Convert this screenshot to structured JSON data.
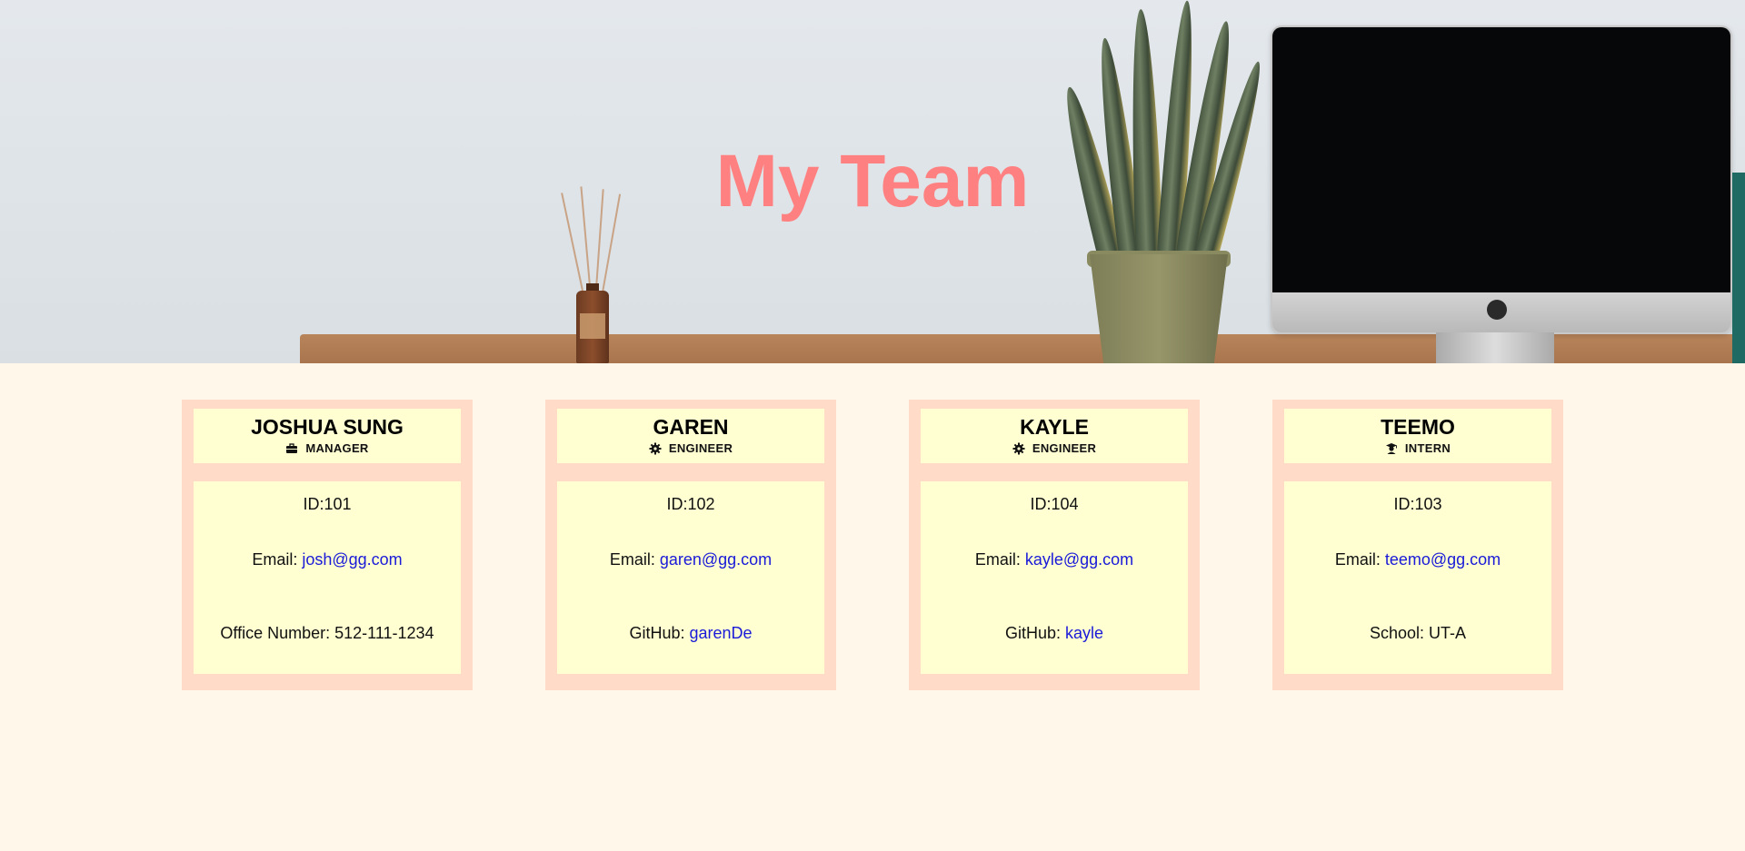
{
  "header": {
    "title": "My Team"
  },
  "colors": {
    "title": "#ff8080",
    "card_border": "#ffdbc8",
    "card_fill": "#ffffd2",
    "page_background": "#fff7e9",
    "link": "#1a1ad8"
  },
  "cards": [
    {
      "name": "JOSHUA SUNG",
      "role": "MANAGER",
      "role_icon": "briefcase-icon",
      "id": "ID:101",
      "email_label": "Email: ",
      "email": "josh@gg.com",
      "extra_label": "Office Number: 512-111-1234",
      "extra_value": ""
    },
    {
      "name": "GAREN",
      "role": "ENGINEER",
      "role_icon": "gear-icon",
      "id": "ID:102",
      "email_label": "Email: ",
      "email": "garen@gg.com",
      "extra_label": "GitHub: ",
      "extra_value": "garenDe"
    },
    {
      "name": "KAYLE",
      "role": "ENGINEER",
      "role_icon": "gear-icon",
      "id": "ID:104",
      "email_label": "Email: ",
      "email": "kayle@gg.com",
      "extra_label": "GitHub: ",
      "extra_value": "kayle"
    },
    {
      "name": "TEEMO",
      "role": "INTERN",
      "role_icon": "graduate-icon",
      "id": "ID:103",
      "email_label": "Email: ",
      "email": "teemo@gg.com",
      "extra_label": "School: UT-A",
      "extra_value": ""
    }
  ]
}
